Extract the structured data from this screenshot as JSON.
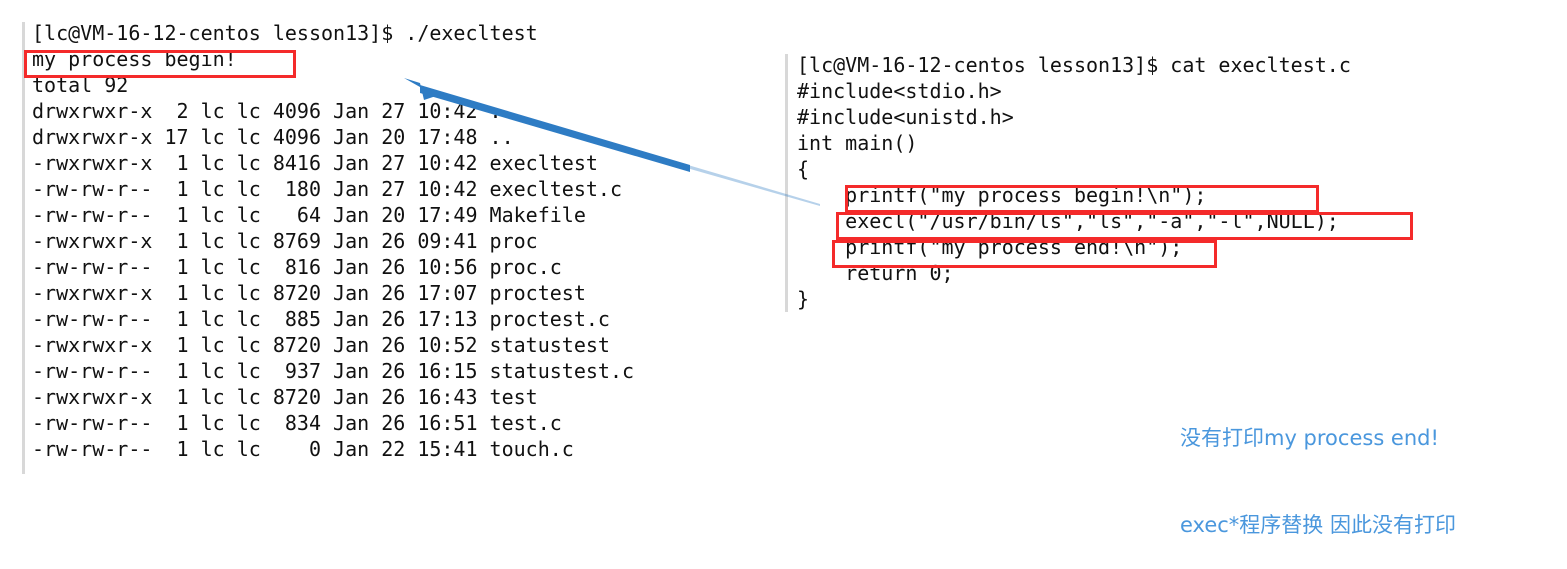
{
  "colors": {
    "highlight_box": "#f42a2a",
    "annotation_blue": "#4a97dd",
    "arrow_blue": "#2e7cc4",
    "terminal_text": "#111111",
    "background": "#ffffff"
  },
  "terminal": {
    "prompt_line": "[lc@VM-16-12-centos lesson13]$ ./execltest",
    "program_output": "my process begin!",
    "total_line": "total 92",
    "listing": [
      "drwxrwxr-x  2 lc lc 4096 Jan 27 10:42 .",
      "drwxrwxr-x 17 lc lc 4096 Jan 20 17:48 ..",
      "-rwxrwxr-x  1 lc lc 8416 Jan 27 10:42 execltest",
      "-rw-rw-r--  1 lc lc  180 Jan 27 10:42 execltest.c",
      "-rw-rw-r--  1 lc lc   64 Jan 20 17:49 Makefile",
      "-rwxrwxr-x  1 lc lc 8769 Jan 26 09:41 proc",
      "-rw-rw-r--  1 lc lc  816 Jan 26 10:56 proc.c",
      "-rwxrwxr-x  1 lc lc 8720 Jan 26 17:07 proctest",
      "-rw-rw-r--  1 lc lc  885 Jan 26 17:13 proctest.c",
      "-rwxrwxr-x  1 lc lc 8720 Jan 26 10:52 statustest",
      "-rw-rw-r--  1 lc lc  937 Jan 26 16:15 statustest.c",
      "-rwxrwxr-x  1 lc lc 8720 Jan 26 16:43 test",
      "-rw-rw-r--  1 lc lc  834 Jan 26 16:51 test.c",
      "-rw-rw-r--  1 lc lc    0 Jan 22 15:41 touch.c"
    ]
  },
  "source_pane": {
    "prompt_line": "[lc@VM-16-12-centos lesson13]$ cat execltest.c",
    "code": [
      "#include<stdio.h>",
      "#include<unistd.h>",
      "int main()",
      "{",
      "    printf(\"my process begin!\\n\");",
      "    execl(\"/usr/bin/ls\",\"ls\",\"-a\",\"-l\",NULL);",
      "    printf(\"my process end!\\n\");",
      "    return 0;",
      "}"
    ]
  },
  "annotation": {
    "line1": "没有打印my process end!",
    "line2": "exec*程序替换 因此没有打印"
  }
}
